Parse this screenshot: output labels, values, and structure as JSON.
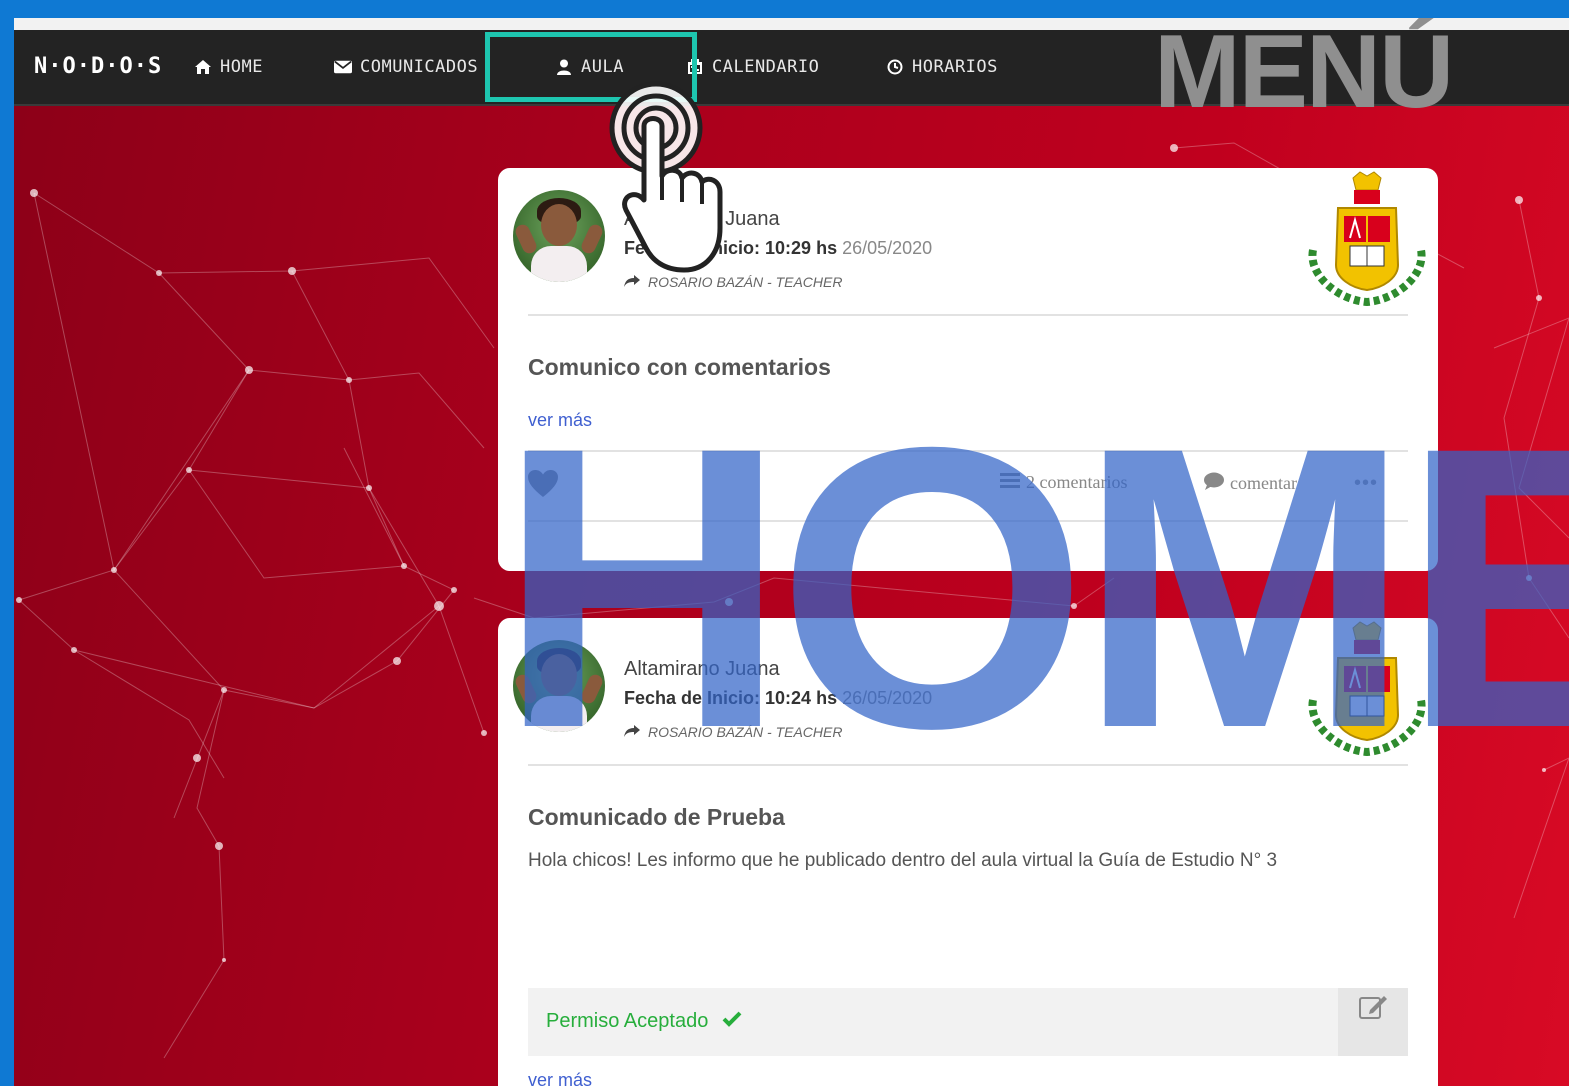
{
  "navbar": {
    "brand": "N·O·D·O·S",
    "items": [
      {
        "label": "HOME",
        "icon": "home-icon"
      },
      {
        "label": "COMUNICADOS",
        "icon": "envelope-icon"
      },
      {
        "label": "AULA",
        "icon": "user-icon"
      },
      {
        "label": "CALENDARIO",
        "icon": "calendar-icon"
      },
      {
        "label": "HORARIOS",
        "icon": "clock-icon"
      }
    ]
  },
  "overlay": {
    "menu_title": "MENÚ",
    "home_title": "HOME"
  },
  "posts": [
    {
      "author": "Altamirano Juana",
      "date_label": "Fecha de Inicio: 10:29 hs",
      "date": "26/05/2020",
      "teacher": "ROSARIO BAZÁN - TEACHER",
      "title": "Comunico con comentarios",
      "ver_mas": "ver más",
      "comments": "2 comentarios",
      "comment_action": "comentar",
      "more": "•••"
    },
    {
      "author": "Altamirano Juana",
      "date_label": "Fecha de Inicio: 10:24 hs",
      "date": "26/05/2020",
      "teacher": "ROSARIO BAZÁN - TEACHER",
      "title": "Comunicado de Prueba",
      "body": "Hola chicos! Les informo que he publicado dentro del aula virtual la Guía de Estudio N° 3",
      "permiso": "Permiso Aceptado",
      "ver_mas": "ver más"
    }
  ],
  "colors": {
    "accent_highlight": "#1ec6b0",
    "link": "#3f5fd0",
    "success": "#27ae3c",
    "navbar": "#232323",
    "background_red": "#c0001e",
    "frame_blue": "#0f79d3"
  }
}
